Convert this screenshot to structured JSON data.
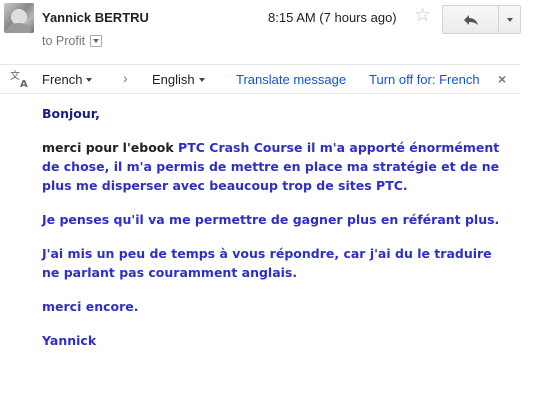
{
  "header": {
    "sender_name": "Yannick BERTRU",
    "recipients": "to Profit",
    "timestamp": "8:15 AM (7 hours ago)"
  },
  "translate_bar": {
    "source_language": "French",
    "target_language": "English",
    "translate_label": "Translate message",
    "turn_off_label": "Turn off for: French"
  },
  "message": {
    "greeting": "Bonjour,",
    "p1_prefix": "merci pour l'ebook",
    "p1_rest": " PTC Crash Course il m'a apporté énormément de chose, il m'a permis de mettre en place ma stratégie et de ne plus me disperser avec beaucoup trop de sites PTC.",
    "p2": "Je penses qu'il va me permettre de gagner plus en référant plus.",
    "p3": "J'ai mis un peu de temps à vous répondre, car j'ai du le traduire ne parlant pas couramment anglais.",
    "p4": "merci encore.",
    "signature": "Yannick"
  },
  "icons": {
    "avatar": "user-avatar",
    "star": "star-icon",
    "reply": "reply-icon",
    "more": "chevron-down-icon",
    "translate": "translate-icon",
    "close": "close-icon"
  },
  "colors": {
    "message_text": "#2f2fc5",
    "link": "#1155cc"
  }
}
